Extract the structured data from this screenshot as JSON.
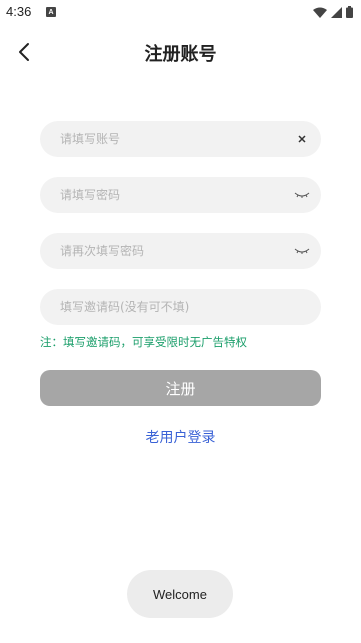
{
  "status_bar": {
    "time": "4:36",
    "notification_glyph": "A"
  },
  "header": {
    "title": "注册账号"
  },
  "form": {
    "account_placeholder": "请填写账号",
    "password_placeholder": "请填写密码",
    "confirm_password_placeholder": "请再次填写密码",
    "invite_code_placeholder": "填写邀请码(没有可不填)",
    "tip": "注：填写邀请码，可享受限时无广告特权",
    "register_label": "注册"
  },
  "login_link": "老用户登录",
  "toast": "Welcome",
  "colors": {
    "accent_link": "#3a62d6",
    "tip_green": "#1a9e6a",
    "button_disabled": "#a6a6a6",
    "field_bg": "#f2f2f2"
  }
}
